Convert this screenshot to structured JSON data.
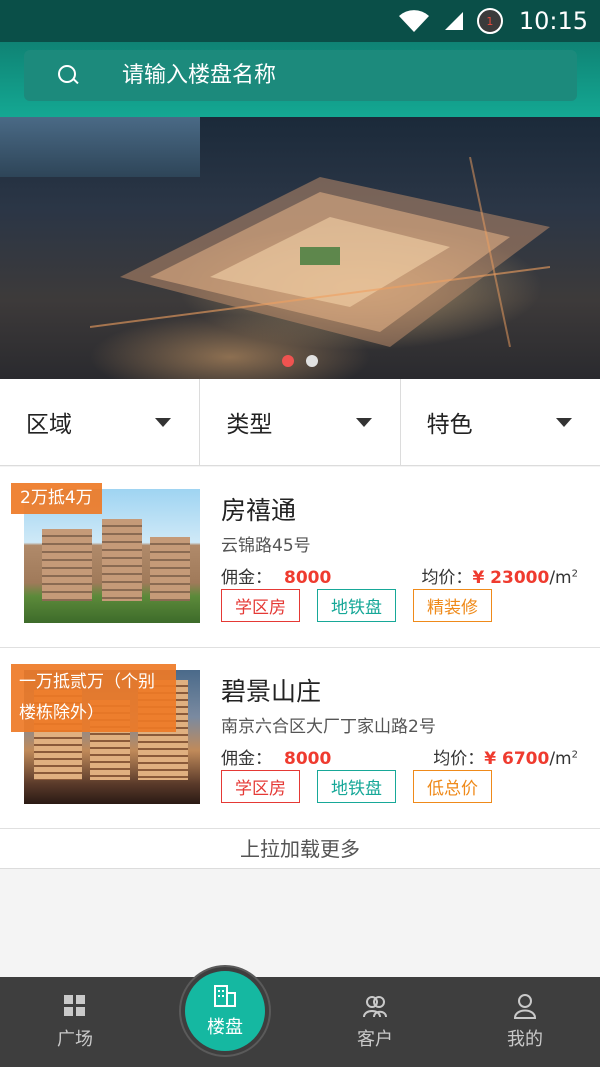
{
  "status_bar": {
    "time": "10:15",
    "notification_count": "1"
  },
  "search": {
    "placeholder": "请输入楼盘名称"
  },
  "banner": {
    "dots": 2,
    "active_dot": 1
  },
  "filters": [
    {
      "label": "区域"
    },
    {
      "label": "类型"
    },
    {
      "label": "特色"
    }
  ],
  "listings": [
    {
      "promo": "2万抵4万",
      "title": "房禧通",
      "address": "云锦路45号",
      "commission_label": "佣金：",
      "commission_value": "8000",
      "avg_label": "均价：",
      "avg_value": "¥ 23000",
      "unit": "/m",
      "unit_sup": "2",
      "tags": [
        "学区房",
        "地铁盘",
        "精装修"
      ]
    },
    {
      "promo": "一万抵贰万（个别楼栋除外）",
      "title": "碧景山庄",
      "address": "南京六合区大厂丁家山路2号",
      "commission_label": "佣金：",
      "commission_value": "8000",
      "avg_label": "均价：",
      "avg_value": "¥ 6700",
      "unit": "/m",
      "unit_sup": "2",
      "tags": [
        "学区房",
        "地铁盘",
        "低总价"
      ]
    }
  ],
  "load_more": "上拉加载更多",
  "bottom_nav": [
    {
      "label": "广场",
      "icon": "grid-icon"
    },
    {
      "label": "楼盘",
      "icon": "building-icon",
      "active": true
    },
    {
      "label": "客户",
      "icon": "users-icon"
    },
    {
      "label": "我的",
      "icon": "person-icon"
    }
  ],
  "colors": {
    "accent": "#15b8a1",
    "header_dark": "#0a4f48",
    "price_red": "#ef3b2f",
    "promo_orange": "#ee7a26",
    "nav_bg": "#3e3e3e"
  }
}
